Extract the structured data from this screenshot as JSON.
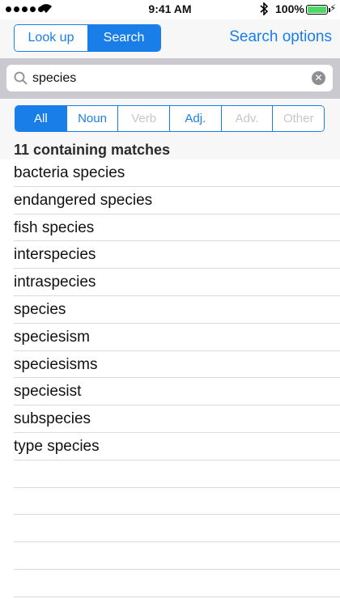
{
  "status_bar": {
    "time": "9:41 AM",
    "battery_percent": "100%",
    "bolt": "⚡"
  },
  "nav": {
    "segments": [
      {
        "label": "Look up",
        "active": false
      },
      {
        "label": "Search",
        "active": true
      }
    ],
    "search_options_label": "Search options"
  },
  "search": {
    "value": "species",
    "clear_icon": "✕"
  },
  "filters": [
    {
      "label": "All",
      "state": "active"
    },
    {
      "label": "Noun",
      "state": "enabled"
    },
    {
      "label": "Verb",
      "state": "disabled"
    },
    {
      "label": "Adj.",
      "state": "enabled"
    },
    {
      "label": "Adv.",
      "state": "disabled"
    },
    {
      "label": "Other",
      "state": "disabled"
    }
  ],
  "results": {
    "header": "11 containing matches",
    "items": [
      "bacteria species",
      "endangered species",
      "fish species",
      "interspecies",
      "intraspecies",
      "species",
      "speciesism",
      "speciesisms",
      "speciesist",
      "subspecies",
      "type species"
    ]
  },
  "colors": {
    "accent": "#1a7ee8",
    "disabled": "#c6c6cc",
    "battery": "#4cd964"
  }
}
